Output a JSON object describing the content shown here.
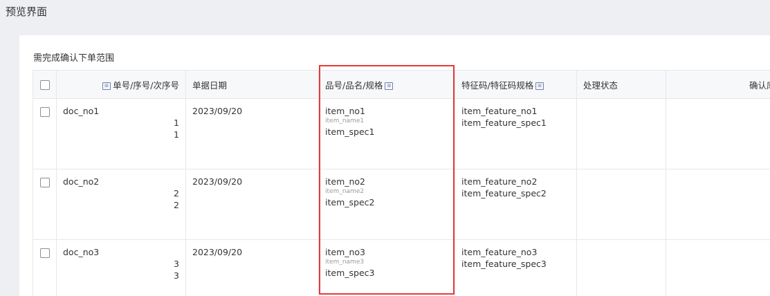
{
  "page": {
    "title": "预览界面"
  },
  "section": {
    "title": "需完成确认下单范围"
  },
  "table": {
    "headers": {
      "doc": "单号/序号/次序号",
      "date": "单据日期",
      "item": "品号/品名/规格",
      "feature": "特征码/特征码规格",
      "status": "处理状态",
      "stock": "确认库存数量"
    },
    "rows": [
      {
        "doc_no": "doc_no1",
        "seq": "1",
        "sub_seq": "1",
        "date": "2023/09/20",
        "item_no": "item_no1",
        "item_name": "item_name1",
        "item_spec": "item_spec1",
        "feature_no": "item_feature_no1",
        "feature_spec": "item_feature_spec1",
        "status": "",
        "stock": ""
      },
      {
        "doc_no": "doc_no2",
        "seq": "2",
        "sub_seq": "2",
        "date": "2023/09/20",
        "item_no": "item_no2",
        "item_name": "item_name2",
        "item_spec": "item_spec2",
        "feature_no": "item_feature_no2",
        "feature_spec": "item_feature_spec2",
        "status": "",
        "stock": ""
      },
      {
        "doc_no": "doc_no3",
        "seq": "3",
        "sub_seq": "3",
        "date": "2023/09/20",
        "item_no": "item_no3",
        "item_name": "item_name3",
        "item_spec": "item_spec3",
        "feature_no": "item_feature_no3",
        "feature_spec": "item_feature_spec3",
        "status": "",
        "stock": ""
      }
    ]
  },
  "icons": {
    "header_icon": "column-toggle-icon"
  },
  "colors": {
    "highlight": "#e53935",
    "background": "#eeeff2",
    "header_bg": "#f7f8fa"
  }
}
